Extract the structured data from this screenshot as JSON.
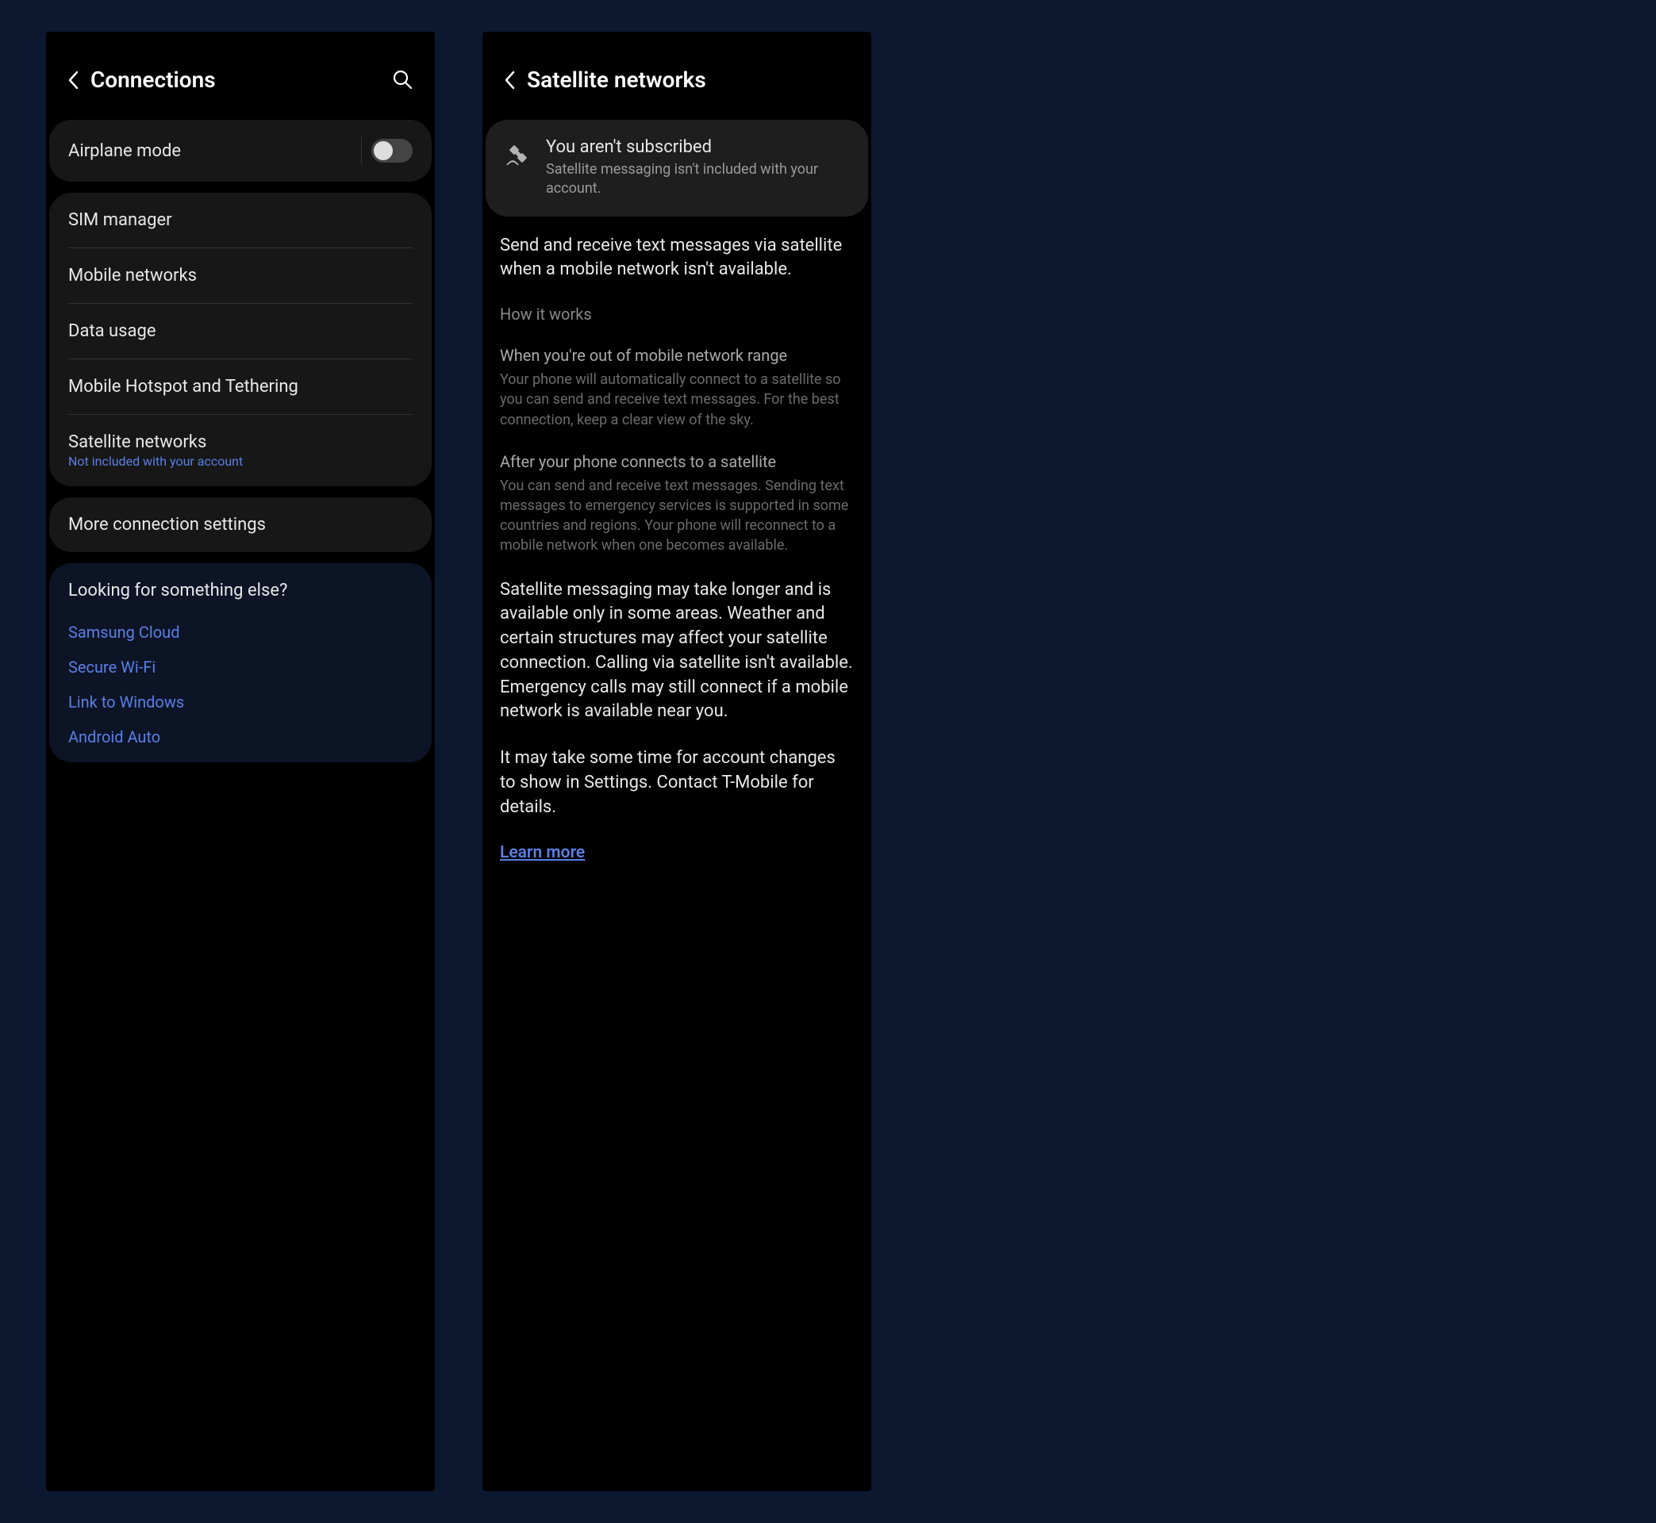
{
  "left": {
    "title": "Connections",
    "airplane": {
      "label": "Airplane mode",
      "on": false
    },
    "group": {
      "sim": "SIM manager",
      "mobile": "Mobile networks",
      "data": "Data usage",
      "hotspot": "Mobile Hotspot and Tethering",
      "satellite": {
        "label": "Satellite networks",
        "sub": "Not included with your account"
      }
    },
    "more": "More connection settings",
    "looking": {
      "heading": "Looking for something else?",
      "links": [
        "Samsung Cloud",
        "Secure Wi-Fi",
        "Link to Windows",
        "Android Auto"
      ]
    }
  },
  "right": {
    "title": "Satellite networks",
    "banner": {
      "title": "You aren't subscribed",
      "sub": "Satellite messaging isn't included with your account."
    },
    "intro": "Send and receive text messages via satellite when a mobile network isn't available.",
    "how_label": "How it works",
    "sec1": {
      "heading": "When you're out of mobile network range",
      "body": "Your phone will automatically connect to a satellite so you can send and receive text messages. For the best connection, keep a clear view of the sky."
    },
    "sec2": {
      "heading": "After your phone connects to a satellite",
      "body": "You can send and receive text messages. Sending text messages to emergency services is supported in some countries and regions. Your phone will reconnect to a mobile network when one becomes available."
    },
    "disclaimer1": "Satellite messaging may take longer and is available only in some areas. Weather and certain structures may affect your satellite connection. Calling via satellite isn't available. Emergency calls may still connect if a mobile network is available near you.",
    "disclaimer2": "It may take some time for account changes to show in Settings. Contact T-Mobile for details.",
    "learn_more": "Learn more"
  }
}
